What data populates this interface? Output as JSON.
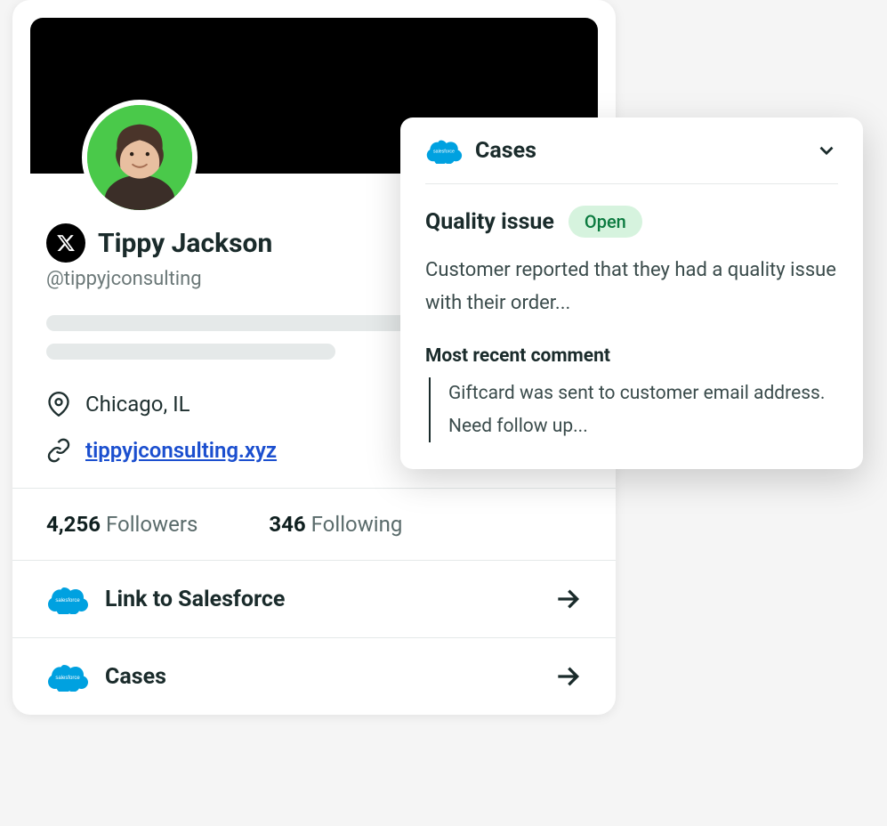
{
  "profile": {
    "display_name": "Tippy Jackson",
    "handle": "@tippyjconsulting",
    "location": "Chicago, IL",
    "website": "tippyjconsulting.xyz",
    "followers_count": "4,256",
    "followers_label": "Followers",
    "following_count": "346",
    "following_label": "Following"
  },
  "actions": {
    "link_sf_label": "Link to Salesforce",
    "cases_label": "Cases"
  },
  "cases_panel": {
    "header_title": "Cases",
    "case_title": "Quality issue",
    "status": "Open",
    "description": "Customer reported that they had a quality issue with their order...",
    "comment_heading": "Most recent comment",
    "comment_body": "Giftcard was sent to customer email address. Need follow up..."
  },
  "colors": {
    "salesforce_blue": "#00a1e0",
    "status_green_bg": "#d6f3de",
    "status_green_text": "#0b7a3f",
    "link_blue": "#1b4fcf"
  }
}
